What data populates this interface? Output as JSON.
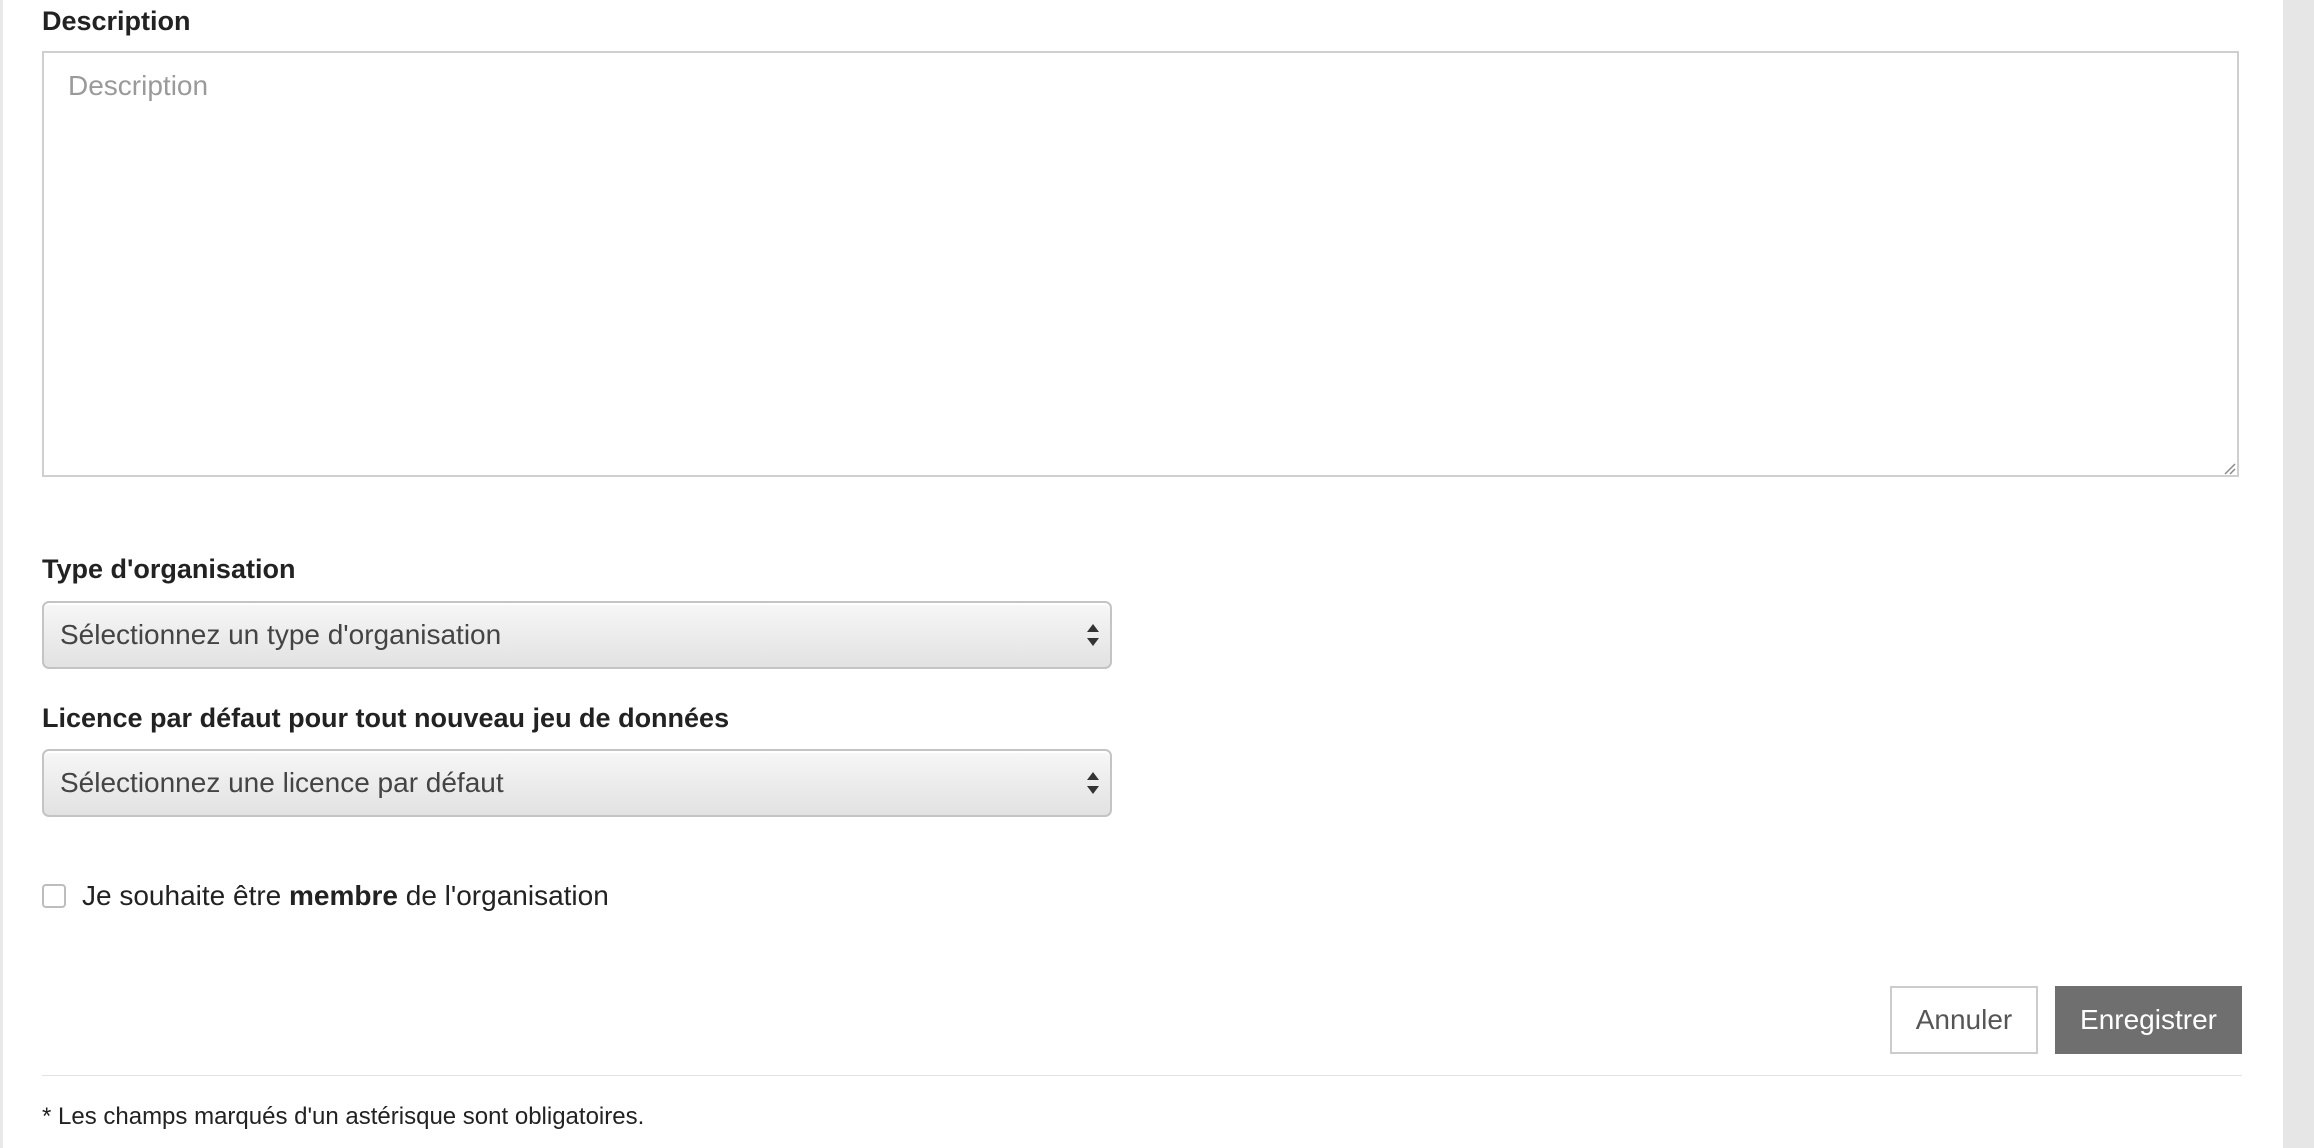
{
  "description": {
    "label": "Description",
    "placeholder": "Description",
    "value": ""
  },
  "org_type": {
    "label": "Type d'organisation",
    "selected": "Sélectionnez un type d'organisation"
  },
  "license": {
    "label": "Licence par défaut pour tout nouveau jeu de données",
    "selected": "Sélectionnez une licence par défaut"
  },
  "membership": {
    "checked": false,
    "label_before": "Je souhaite être ",
    "label_bold": "membre",
    "label_after": " de l'organisation"
  },
  "actions": {
    "cancel_label": "Annuler",
    "save_label": "Enregistrer"
  },
  "footer": {
    "required_note": "* Les champs marqués d'un astérisque sont obligatoires."
  },
  "colors": {
    "save_button_bg": "#6f6f6f",
    "scrollbar_rail": "#e6e6e6"
  },
  "icons": {
    "select_arrows": "up-down-arrows-icon",
    "resize_grip": "resize-grip-icon"
  }
}
